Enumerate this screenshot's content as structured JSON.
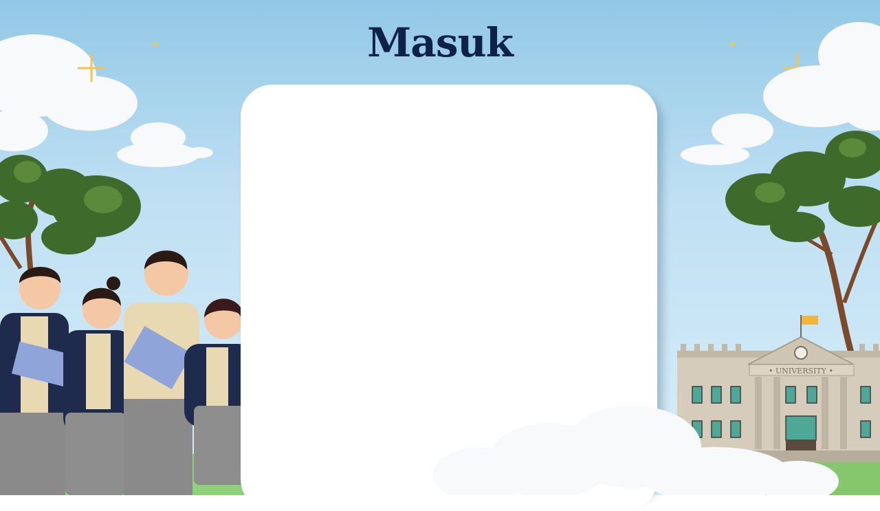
{
  "header": {
    "title": "Masuk"
  },
  "building": {
    "sign": "• UNIVERSITY •"
  },
  "colors": {
    "title": "#0e2147",
    "sky": "#a9d5ee",
    "card": "#ffffff",
    "blazer": "#1e2b4d"
  }
}
